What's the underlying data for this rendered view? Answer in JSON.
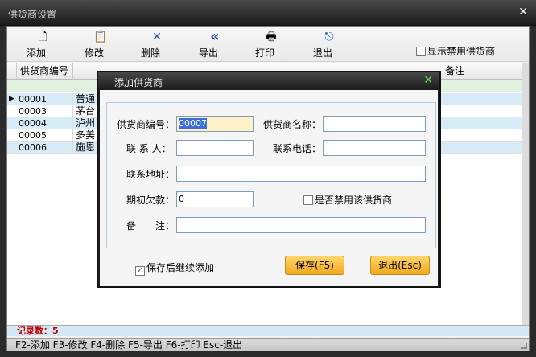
{
  "window": {
    "title": "供货商设置",
    "close_glyph": "✕"
  },
  "toolbar": {
    "buttons": [
      {
        "label": "添加",
        "icon": "file-new-icon",
        "glyph": "🗋"
      },
      {
        "label": "修改",
        "icon": "edit-clipboard-icon",
        "glyph": "📋"
      },
      {
        "label": "删除",
        "icon": "delete-x-icon",
        "glyph": "✕"
      },
      {
        "label": "导出",
        "icon": "export-arrows-icon",
        "glyph": "«"
      },
      {
        "label": "打印",
        "icon": "printer-icon",
        "glyph": "🖶"
      },
      {
        "label": "退出",
        "icon": "exit-door-icon",
        "glyph": "⎋"
      }
    ],
    "show_disabled_label": "显示禁用供货商"
  },
  "grid": {
    "columns": [
      "供货商编号",
      "备注"
    ],
    "rows": [
      {
        "code": "00001",
        "name": "普通"
      },
      {
        "code": "00003",
        "name": "茅台"
      },
      {
        "code": "00004",
        "name": "泸州"
      },
      {
        "code": "00005",
        "name": "多美"
      },
      {
        "code": "00006",
        "name": "施恩"
      }
    ],
    "record_count_label": "记录数：5"
  },
  "statusbar": {
    "text": "F2-添加 F3-修改 F4-删除 F5-导出 F6-打印 Esc-退出"
  },
  "dialog": {
    "title": "添加供货商",
    "close_glyph": "✕",
    "fields": {
      "code_label": "供货商编号：",
      "code_value": "00007",
      "name_label": "供货商名称：",
      "name_value": "",
      "contact_label": "联 系 人：",
      "contact_value": "",
      "phone_label": "联系电话：",
      "phone_value": "",
      "address_label": "联系地址：",
      "address_value": "",
      "opening_debt_label": "期初欠款：",
      "opening_debt_value": "0",
      "disable_label": "是否禁用该供货商",
      "remark_label": "备　　注：",
      "remark_value": ""
    },
    "keep_adding_label": "保存后继续添加",
    "keep_adding_checked": true,
    "save_label": "保存(F5)",
    "exit_label": "退出(Esc)"
  },
  "colors": {
    "accent_button": "#f3a91b",
    "row_selected": "#d8ecf8",
    "record_count": "#c00000"
  }
}
